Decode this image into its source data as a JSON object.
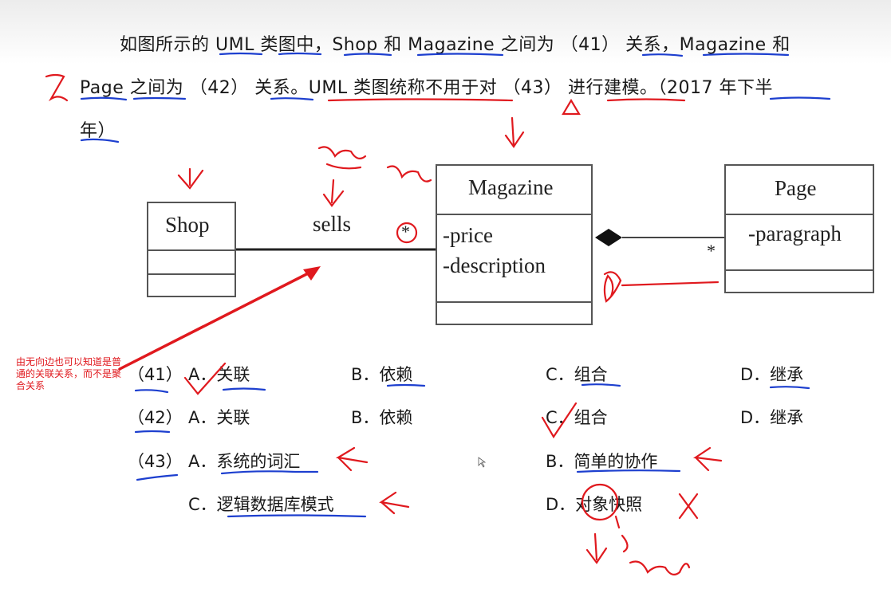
{
  "question": {
    "line1": "如图所示的 UML 类图中，Shop 和 Magazine 之间为 （41） 关系，Magazine 和",
    "line2": "Page 之间为 （42） 关系。UML 类图统称不用于对 （43） 进行建模。（2017 年下半",
    "line3": "年）"
  },
  "diagram": {
    "shop": {
      "name": "Shop"
    },
    "association_label": "sells",
    "magazine": {
      "name": "Magazine",
      "attributes": [
        "-price",
        "-description"
      ],
      "multiplicity": "*"
    },
    "page": {
      "name": "Page",
      "attributes": [
        "-paragraph"
      ],
      "multiplicity": "*"
    }
  },
  "answers": [
    {
      "number": "（41）",
      "options": [
        "A．关联",
        "B．依赖",
        "C．组合",
        "D．继承"
      ]
    },
    {
      "number": "（42）",
      "options": [
        "A．关联",
        "B．依赖",
        "C．组合",
        "D．继承"
      ]
    },
    {
      "number": "（43）",
      "options": [
        "A．系统的词汇",
        "B．简单的协作",
        "C．逻辑数据库模式",
        "D．对象快照"
      ]
    }
  ],
  "annotation_note": "由无向边也可以知道是普通的关联关系，而不是聚合关系",
  "colors": {
    "ink_red": "#e0191e",
    "ink_blue": "#1d3fcf",
    "border": "#555555"
  }
}
